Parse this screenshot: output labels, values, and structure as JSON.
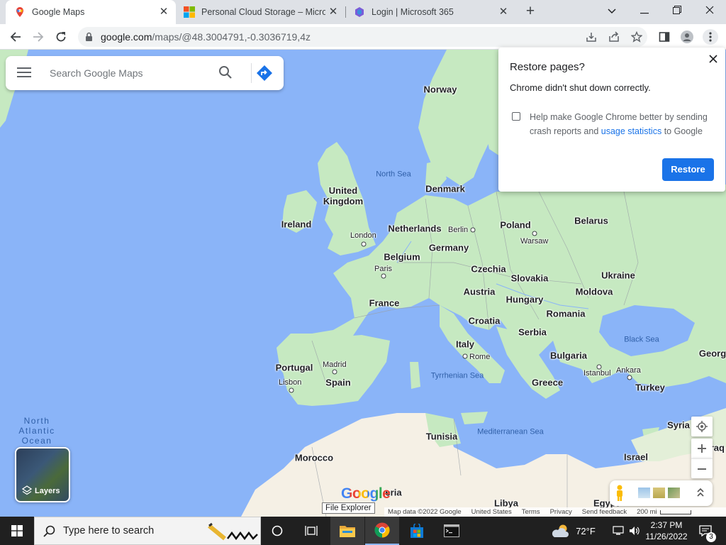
{
  "browser": {
    "tabs": [
      {
        "title": "Google Maps",
        "active": true
      },
      {
        "title": "Personal Cloud Storage – Microsoft",
        "active": false
      },
      {
        "title": "Login | Microsoft 365",
        "active": false
      }
    ],
    "url_host": "google.com",
    "url_path": "/maps/@48.3004791,-0.3036719,4z"
  },
  "search": {
    "placeholder": "Search Google Maps"
  },
  "popup": {
    "title": "Restore pages?",
    "message": "Chrome didn't shut down correctly.",
    "help_text_1": "Help make Google Chrome better by sending crash reports and ",
    "help_link": "usage statistics",
    "help_text_2": " to Google",
    "restore_label": "Restore"
  },
  "map": {
    "countries": [
      "Norway",
      "Denmark",
      "United Kingdom",
      "Ireland",
      "Netherlands",
      "Belgium",
      "Germany",
      "Poland",
      "Belarus",
      "Ukraine",
      "Czechia",
      "Slovakia",
      "Austria",
      "Hungary",
      "Moldova",
      "France",
      "Romania",
      "Croatia",
      "Serbia",
      "Italy",
      "Bulgaria",
      "Portugal",
      "Spain",
      "Greece",
      "Turkey",
      "Tunisia",
      "Morocco",
      "Syria",
      "Israel",
      "Georg",
      "Iraq",
      "Libya",
      "Egypt",
      "eria"
    ],
    "cities": [
      "London",
      "Berlin",
      "Warsaw",
      "Paris",
      "Madrid",
      "Lisbon",
      "Rome",
      "Istanbul",
      "Ankara"
    ],
    "seas": [
      "North Sea",
      "Black Sea",
      "Tyrrhenian Sea",
      "Mediterranean Sea"
    ],
    "ocean": [
      "North",
      "Atlantic",
      "Ocean"
    ],
    "layers_label": "Layers",
    "logo": "Google",
    "footer": {
      "data": "Map data ©2022 Google",
      "country": "United States",
      "terms": "Terms",
      "privacy": "Privacy",
      "feedback": "Send feedback",
      "scale": "200 mi"
    }
  },
  "tooltip": "File Explorer",
  "taskbar": {
    "search_placeholder": "Type here to search",
    "weather": "72°F",
    "time": "2:37 PM",
    "date": "11/26/2022",
    "notifications": "3"
  },
  "colors": {
    "water": "#8ab4f8",
    "land": "#c6e9c1",
    "accent": "#1a73e8",
    "taskbar": "#202020"
  }
}
